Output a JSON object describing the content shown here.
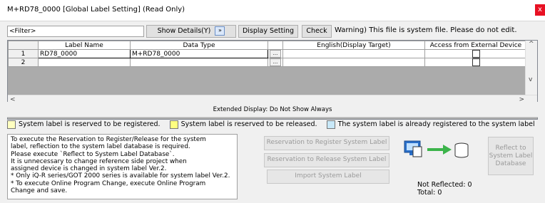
{
  "window": {
    "title": "M+RD78_0000 [Global Label Setting] (Read Only)",
    "close_label": "x"
  },
  "toolbar": {
    "filter_placeholder": "<Filter>",
    "show_details_label": "Show Details(Y)",
    "expand_icon": "»",
    "display_setting_label": "Display Setting",
    "check_label": "Check",
    "warning_text": "Warning) This file is system file. Please do not edit."
  },
  "grid": {
    "columns": [
      "Label Name",
      "Data Type",
      "",
      "English(Display Target)",
      "Access from External Device"
    ],
    "rows": [
      {
        "num": "1",
        "label": "RD78_0000",
        "type": "M+RD78_0000",
        "english": ""
      },
      {
        "num": "2",
        "label": "",
        "type": "",
        "english": ""
      }
    ],
    "dots": "..."
  },
  "extended_display": "Extended Display: Do Not Show Always",
  "legend": [
    {
      "text": "System label is reserved to be registered.",
      "color": "#ffffc0"
    },
    {
      "text": "System label is reserved to be released.",
      "color": "#ffff80"
    },
    {
      "text": "The system label is already registered to the system label database.",
      "color": "#c8e8f8"
    }
  ],
  "info_text": "To execute the Reservation to Register/Release for the system\nlabel, reflection to the system label database is required.\nPlease execute `Reflect to System Label Database`.\nIt is unnecessary to change reference side project when\nassigned device is changed in system label Ver.2.\n* Only iQ-R series/GOT 2000 series is available for system label Ver.2.\n* To execute Online Program Change, execute Online Program\nChange and save.",
  "actions": {
    "register": "Reservation to Register System Label",
    "release": "Reservation to Release System Label",
    "import": "Import System Label",
    "reflect": "Reflect to\nSystem Label\nDatabase"
  },
  "status": {
    "not_reflected": "Not Reflected: 0",
    "total": "Total: 0"
  }
}
